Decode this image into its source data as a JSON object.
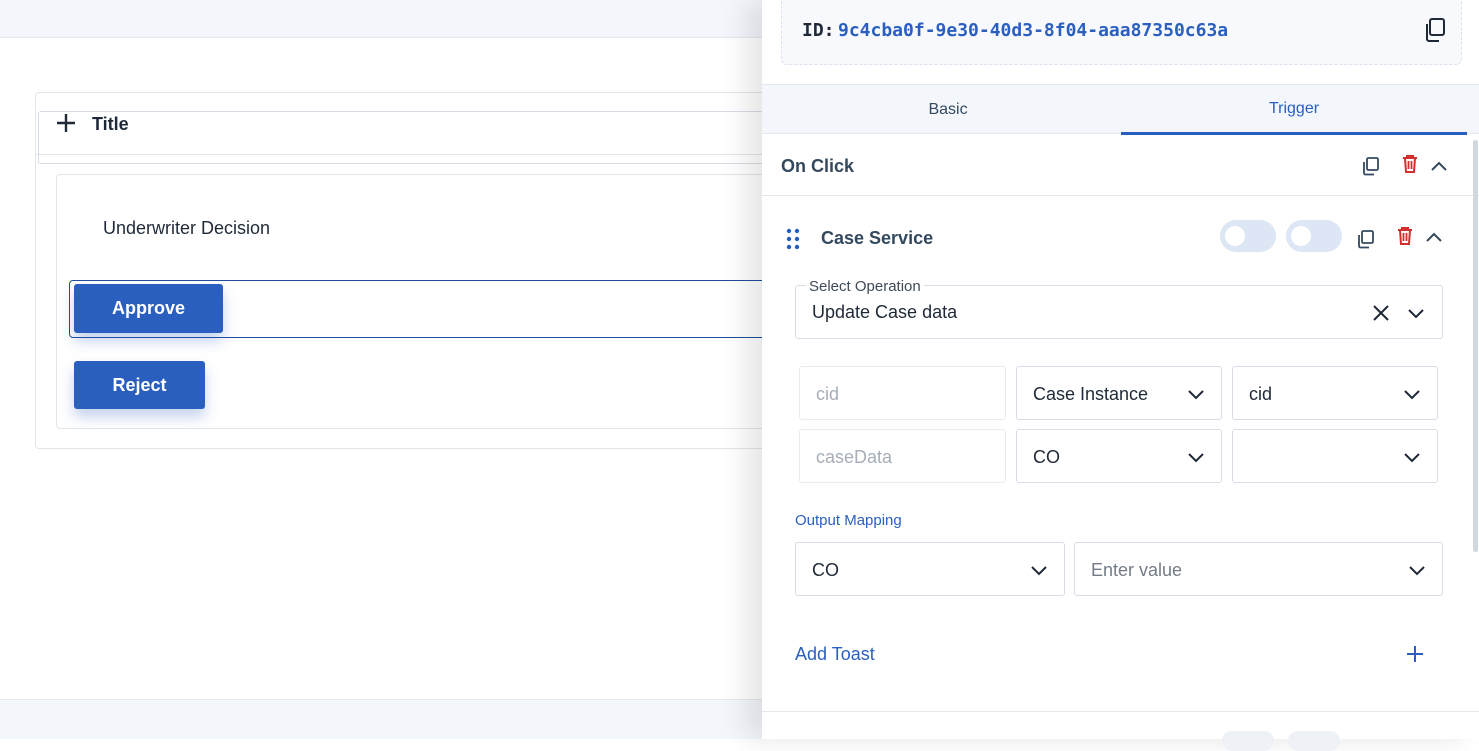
{
  "canvas": {
    "card_title": "Title",
    "field_text": "Underwriter Decision",
    "approve_label": "Approve",
    "reject_label": "Reject"
  },
  "panel": {
    "id_label": "ID:",
    "id_value": "9c4cba0f-9e30-40d3-8f04-aaa87350c63a",
    "tabs": [
      {
        "label": "Basic",
        "active": false
      },
      {
        "label": "Trigger",
        "active": true
      }
    ],
    "event_title": "On Click",
    "action_title": "Case Service",
    "select_operation_label": "Select Operation",
    "select_operation_value": "Update Case data",
    "params": [
      {
        "name": "cid",
        "source": "Case Instance",
        "value": "cid"
      },
      {
        "name": "caseData",
        "source": "CO",
        "value": ""
      }
    ],
    "output_mapping_label": "Output Mapping",
    "output_mapping": {
      "source": "CO",
      "placeholder": "Enter value"
    },
    "add_toast_label": "Add Toast"
  },
  "colors": {
    "accent": "#2a5fbf",
    "delete": "#d32f2f"
  },
  "icons": [
    "plus-icon",
    "copy-icon",
    "trash-icon",
    "chevron-up-icon",
    "chevron-down-icon",
    "drag-handle-icon",
    "clear-icon"
  ]
}
